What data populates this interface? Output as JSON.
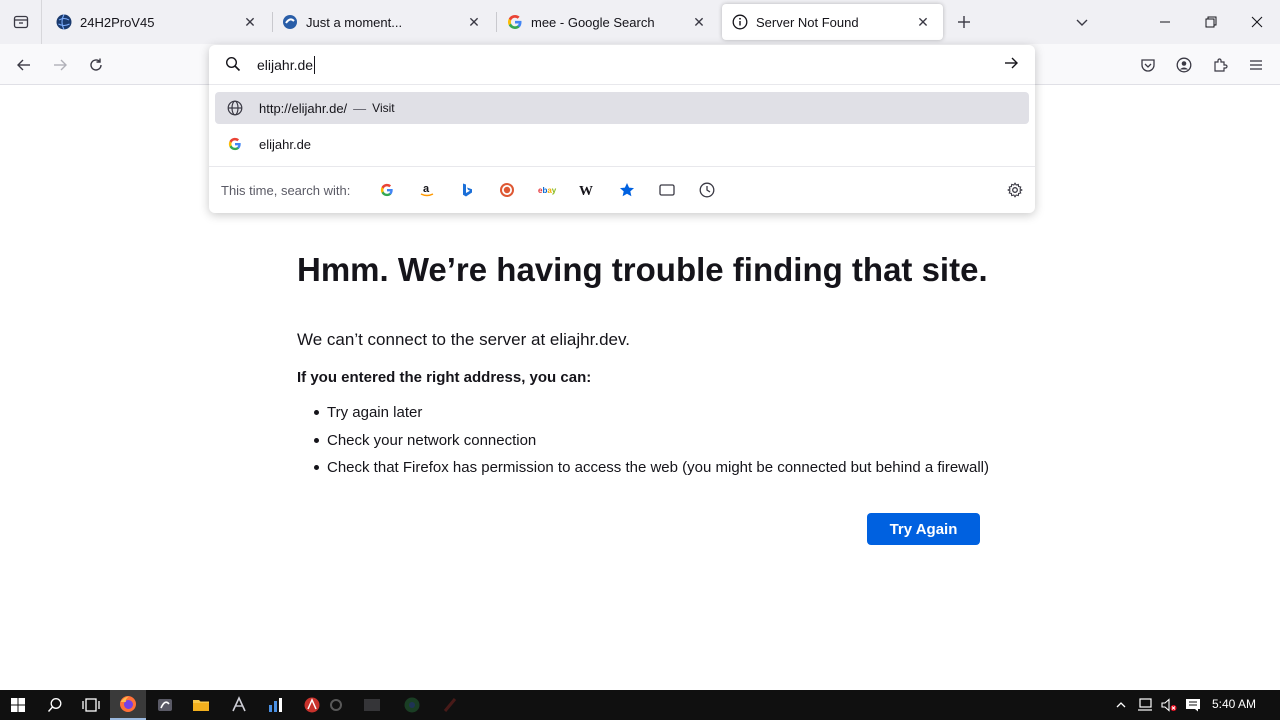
{
  "tabs": [
    {
      "title": "24H2ProV45",
      "icon": "globe-dark-icon",
      "active": false
    },
    {
      "title": "Just a moment...",
      "icon": "loading-icon",
      "active": false
    },
    {
      "title": "mee - Google Search",
      "icon": "google-icon",
      "active": false
    },
    {
      "title": "Server Not Found",
      "icon": "info-icon",
      "active": true
    }
  ],
  "urlbar": {
    "value": "elijahr.de",
    "suggestions": [
      {
        "icon": "globe-icon",
        "text": "http://elijahr.de/",
        "action": "Visit",
        "highlighted": true
      },
      {
        "icon": "google-icon",
        "text": "elijahr.de",
        "action": "",
        "highlighted": false
      }
    ],
    "oneoff_label": "This time, search with:",
    "engines": [
      "google-icon",
      "amazon-icon",
      "bing-icon",
      "duckduckgo-icon",
      "ebay-icon",
      "wikipedia-icon",
      "bookmarks-icon",
      "tabs-icon",
      "history-icon"
    ]
  },
  "error": {
    "title": "Hmm. We’re having trouble finding that site.",
    "description": "We can’t connect to the server at eliajhr.dev.",
    "hint": "If you entered the right address, you can:",
    "items": [
      "Try again later",
      "Check your network connection",
      "Check that Firefox has permission to access the web (you might be connected but behind a firewall)"
    ],
    "button": "Try Again"
  },
  "taskbar": {
    "clock": "5:40 AM"
  },
  "colors": {
    "accent": "#0061e0",
    "tabstrip_bg": "#f0f0f4",
    "taskbar_bg": "#101010"
  }
}
